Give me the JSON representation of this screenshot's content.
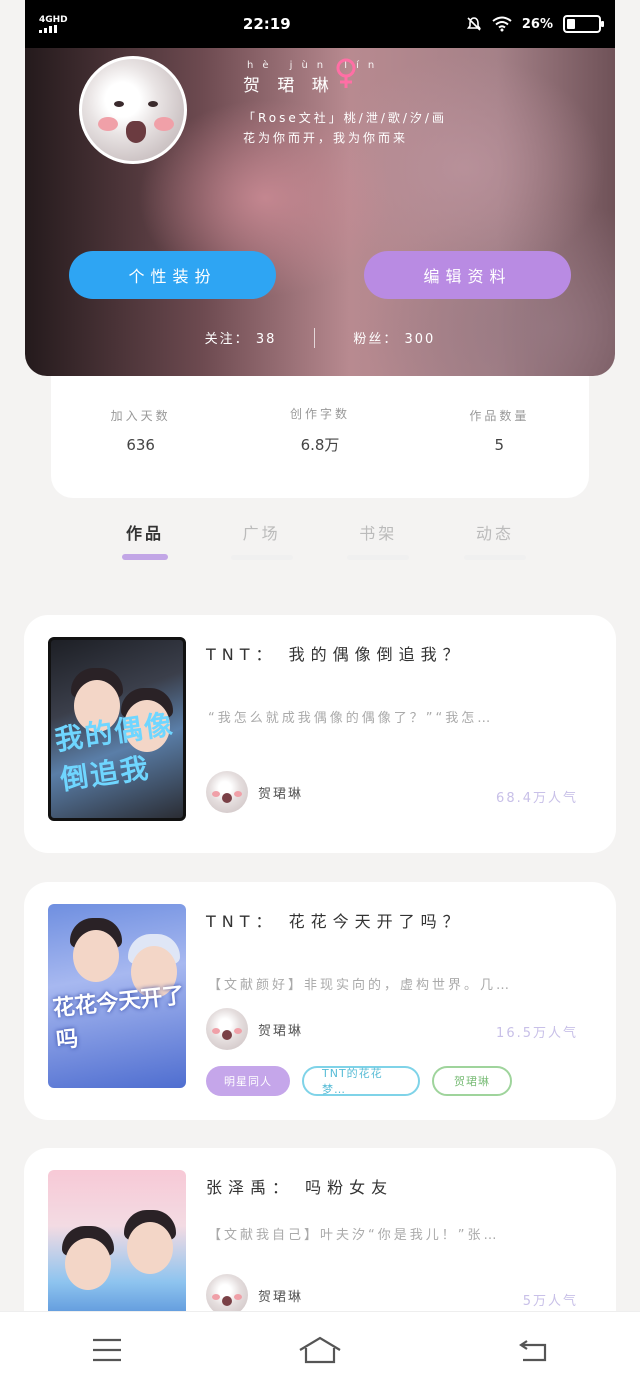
{
  "status_bar": {
    "network": "4GHD",
    "time": "22:19",
    "battery": "26%",
    "battery_level": 0.26
  },
  "profile": {
    "name": "贺 珺 琳",
    "name_pinyin": "hè jùn lín",
    "bio_line1": "「Rose文社」桃/泄/歌/汐/画",
    "bio_line2": "花为你而开，我为你而来",
    "dressup_button": "个性装扮",
    "edit_button": "编辑资料",
    "following_label": "关注：",
    "following_count": "38",
    "followers_label": "粉丝：",
    "followers_count": "300"
  },
  "stats": [
    {
      "label": "加入天数",
      "value": "636"
    },
    {
      "label": "创作字数",
      "value": "6.8万"
    },
    {
      "label": "作品数量",
      "value": "5"
    }
  ],
  "tabs": [
    {
      "label": "作品",
      "active": true
    },
    {
      "label": "广场",
      "active": false
    },
    {
      "label": "书架",
      "active": false
    },
    {
      "label": "动态",
      "active": false
    }
  ],
  "works": [
    {
      "title": "TNT： 我的偶像倒追我？",
      "excerpt": "“我怎么就成我偶像的偶像了？”“我怎…",
      "author": "贺珺琳",
      "popularity": "68.4万人气",
      "cover_text": "我的偶像倒追我"
    },
    {
      "title": "TNT： 花花今天开了吗？",
      "excerpt": "【文献颜好】非现实向的，虚构世界。几…",
      "author": "贺珺琳",
      "popularity": "16.5万人气",
      "cover_text": "花花今天开了吗",
      "tags": [
        "明星同人",
        "TNT的花花梦…",
        "贺珺琳"
      ]
    },
    {
      "title": "张泽禹： 吗粉女友",
      "excerpt": "【文献我自己】叶夫汐“你是我儿！”张…",
      "author": "贺珺琳",
      "popularity": "5万人气"
    }
  ],
  "colors": {
    "accent_blue": "#2ea5f3",
    "accent_purple": "#b98be3",
    "tab_indicator": "#c2a6e6"
  },
  "icons": [
    "menu-icon",
    "home-icon",
    "back-icon",
    "female-icon",
    "wifi-icon",
    "mute-icon"
  ]
}
